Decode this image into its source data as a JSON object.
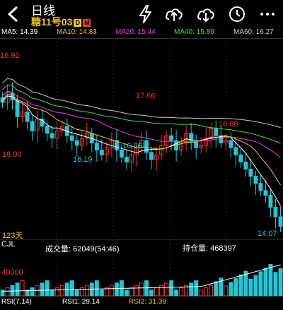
{
  "header": {
    "title": "日线",
    "subtitle": "糖11号03",
    "badge_d": "D",
    "badge_m": "M"
  },
  "ma": {
    "ma5": {
      "label": "MA5: 14.39",
      "color": "#ffffff"
    },
    "ma10": {
      "label": "MA10: 14.83",
      "color": "#f0c419"
    },
    "ma20": {
      "label": "MA20: 15.44",
      "color": "#e040e0"
    },
    "ma40": {
      "label": "MA40: 15.89",
      "color": "#40e040"
    },
    "ma60": {
      "label": "MA60: 16.27",
      "color": "#cccccc"
    }
  },
  "price": {
    "axis_top": "16.92",
    "axis_mid": "16.00",
    "axis_days": "123天",
    "peak1": "17.66",
    "peak2": "16.88",
    "low1": "16.19",
    "low2": "16.56",
    "low3": "14.07"
  },
  "volume": {
    "indicator": "CJL",
    "vol_label": "成交量: 62049(54:46)",
    "oi_label": "持仓量: 468397",
    "axis": "40000"
  },
  "footer": {
    "rsi": "RSI(7,14)",
    "rsi1": "RSI1: 29.14",
    "rsi2": "RSI2: 31.39"
  },
  "colors": {
    "up": "#f03a2a",
    "down": "#22c7d6",
    "label_red": "#f03a2a",
    "label_cyan": "#22c7d6",
    "oi_line": "#ffffff"
  },
  "chart_data": {
    "type": "candlestick",
    "closes": [
      16.7,
      16.9,
      16.75,
      16.4,
      16.5,
      16.3,
      16.1,
      16.35,
      16.2,
      16.05,
      15.95,
      16.1,
      16.2,
      16.0,
      15.9,
      15.8,
      15.95,
      16.05,
      15.85,
      15.7,
      15.6,
      15.75,
      15.9,
      15.7,
      15.55,
      15.45,
      15.6,
      15.75,
      15.9,
      15.65,
      15.5,
      15.6,
      15.8,
      16.0,
      15.9,
      15.7,
      15.85,
      16.05,
      15.9,
      15.75,
      15.8,
      15.95,
      16.15,
      16.0,
      15.85,
      15.9,
      15.75,
      15.6,
      15.45,
      15.3,
      15.15,
      15.0,
      14.85,
      14.75,
      14.5,
      14.3,
      14.1
    ]
  }
}
